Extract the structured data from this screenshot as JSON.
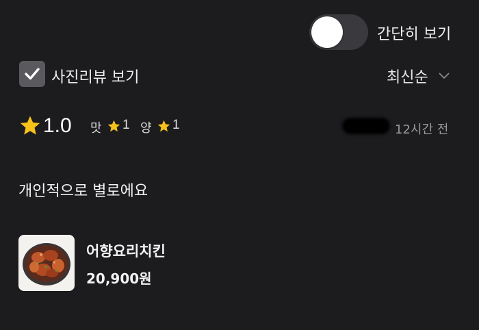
{
  "view_toggle": {
    "label": "간단히 보기",
    "enabled": false
  },
  "photo_filter": {
    "label": "사진리뷰 보기",
    "checked": true
  },
  "sort": {
    "selected": "최신순"
  },
  "review": {
    "rating": "1.0",
    "taste_label": "맛",
    "taste_score": "1",
    "amount_label": "양",
    "amount_score": "1",
    "time_ago": "12시간 전",
    "text": "개인적으로 별로에요"
  },
  "ordered_item": {
    "name": "어향요리치킨",
    "price": "20,900원"
  },
  "colors": {
    "background": "#1c1c1f",
    "star": "#f7c31b",
    "text": "#f2f2f2",
    "muted_text": "#9a9a9e",
    "toggle_track": "#3a3a3e",
    "checkbox": "#5a5a5e"
  }
}
